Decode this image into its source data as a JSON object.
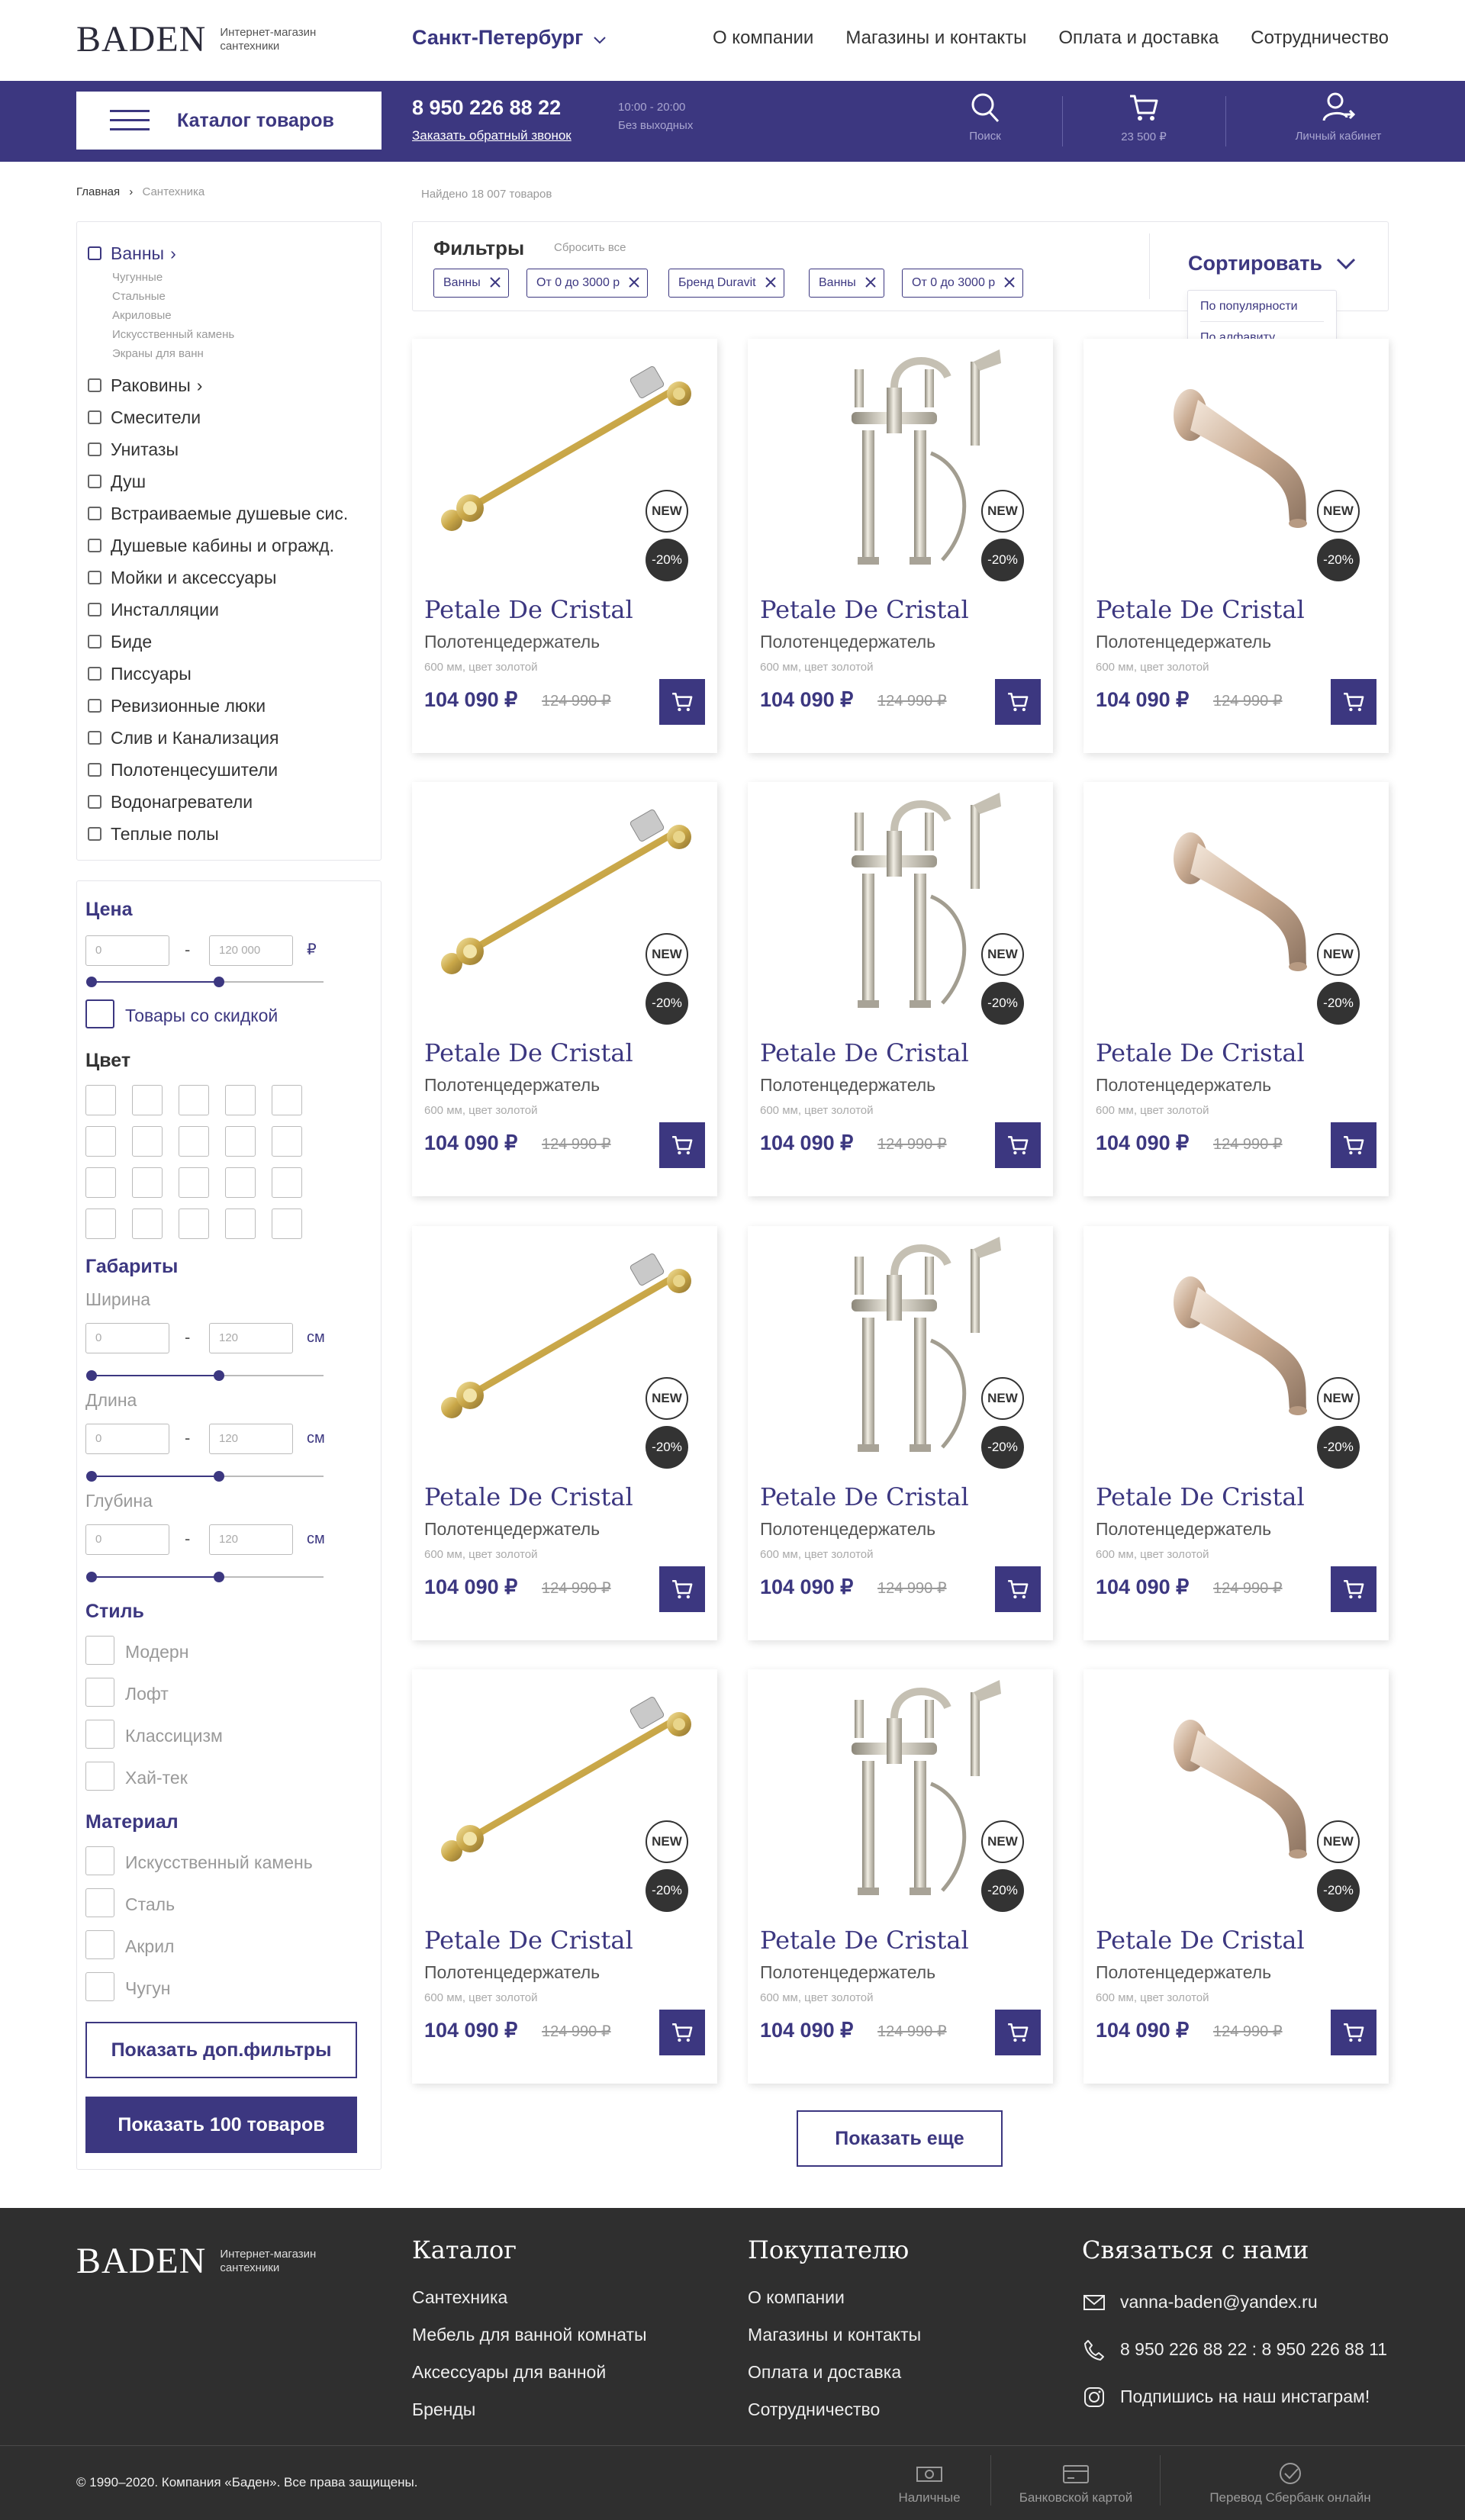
{
  "header": {
    "logo": "BADEN",
    "logo_sub_1": "Интернет-магазин",
    "logo_sub_2": "сантехники",
    "city": "Санкт-Петербург",
    "nav": [
      "О компании",
      "Магазины и контакты",
      "Оплата и доставка",
      "Сотрудничество"
    ],
    "catalog_label": "Каталог товаров",
    "phone": "8 950 226 88 22",
    "callback": "Заказать обратный звонок",
    "hours": "10:00 - 20:00",
    "days": "Без выходных",
    "search_label": "Поиск",
    "cart_label": "23 500 ₽",
    "account_label": "Личный кабинет"
  },
  "breadcrumbs": {
    "home": "Главная",
    "current": "Сантехника"
  },
  "found_text": "Найдено 18 007 товаров",
  "categories": {
    "active": "Ванны",
    "sub": [
      "Чугунные",
      "Стальные",
      "Акриловые",
      "Искусственный камень",
      "Экраны для ванн"
    ],
    "items": [
      "Раковины",
      "Смесители",
      "Унитазы",
      "Душ",
      "Встраиваемые душевые сис.",
      "Душевые кабины и огражд.",
      "Мойки и аксессуары",
      "Инсталляции",
      "Биде",
      "Писсуары",
      "Ревизионные люки",
      "Слив и Канализация",
      "Полотенцесушители",
      "Водонагреватели",
      "Теплые полы"
    ]
  },
  "filters_side": {
    "price_title": "Цена",
    "price_from": "0",
    "price_to": "120 000",
    "currency": "₽",
    "price_range_fraction": [
      0,
      0.55
    ],
    "discount_label": "Товары со скидкой",
    "color_title": "Цвет",
    "size_title": "Габариты",
    "width_label": "Ширина",
    "length_label": "Длина",
    "depth_label": "Глубина",
    "size_from": "0",
    "size_to": "120",
    "size_unit": "см",
    "size_range_fraction": [
      0,
      0.55
    ],
    "style_title": "Стиль",
    "styles": [
      "Модерн",
      "Лофт",
      "Классицизм",
      "Хай-тек"
    ],
    "material_title": "Материал",
    "materials": [
      "Искусственный камень",
      "Сталь",
      "Акрил",
      "Чугун"
    ],
    "more_filters": "Показать доп.фильтры",
    "show_btn": "Показать 100 товаров"
  },
  "filters_top": {
    "title": "Фильтры",
    "reset": "Сбросить все",
    "chips": [
      "Ванны",
      "От 0 до 3000 р",
      "Бренд Duravit",
      "Ванны",
      "От 0 до 3000 р"
    ],
    "sort_label": "Сортировать",
    "sort_options": [
      "По популярности",
      "По алфавиту"
    ]
  },
  "product": {
    "title": "Petale De Cristal",
    "type": "Полотенцедержатель",
    "desc": "600 мм, цвет золотой",
    "price": "104 090 ₽",
    "old_price": "124 990 ₽",
    "badge_new": "NEW",
    "badge_sale": "-20%",
    "images": [
      "towel-bar",
      "bath-mixer",
      "spout",
      "towel-bar",
      "bath-mixer",
      "spout",
      "towel-bar",
      "bath-mixer",
      "spout",
      "towel-bar",
      "bath-mixer",
      "spout"
    ]
  },
  "show_more": "Показать еще",
  "footer": {
    "logo": "BADEN",
    "logo_sub_1": "Интернет-магазин",
    "logo_sub_2": "сантехники",
    "catalog_title": "Каталог",
    "catalog_links": [
      "Сантехника",
      "Мебель для ванной комнаты",
      "Аксессуары для ванной",
      "Бренды"
    ],
    "buyer_title": "Покупателю",
    "buyer_links": [
      "О компании",
      "Магазины и контакты",
      "Оплата и доставка",
      "Сотрудничество"
    ],
    "contact_title": "Связаться с нами",
    "email": "vanna-baden@yandex.ru",
    "phones": "8 950 226 88 22 : 8 950 226 88 11",
    "instagram": "Подпишись на наш инстаграм!",
    "copyright": "© 1990–2020. Компания «Баден». Все права защищены.",
    "pay_methods": [
      "Наличные",
      "Банковской картой",
      "Перевод Сбербанк онлайн"
    ]
  },
  "colors": {
    "accent": "#3c3780",
    "footer_bg": "#2f2f2f",
    "badge_dark": "#333333"
  }
}
